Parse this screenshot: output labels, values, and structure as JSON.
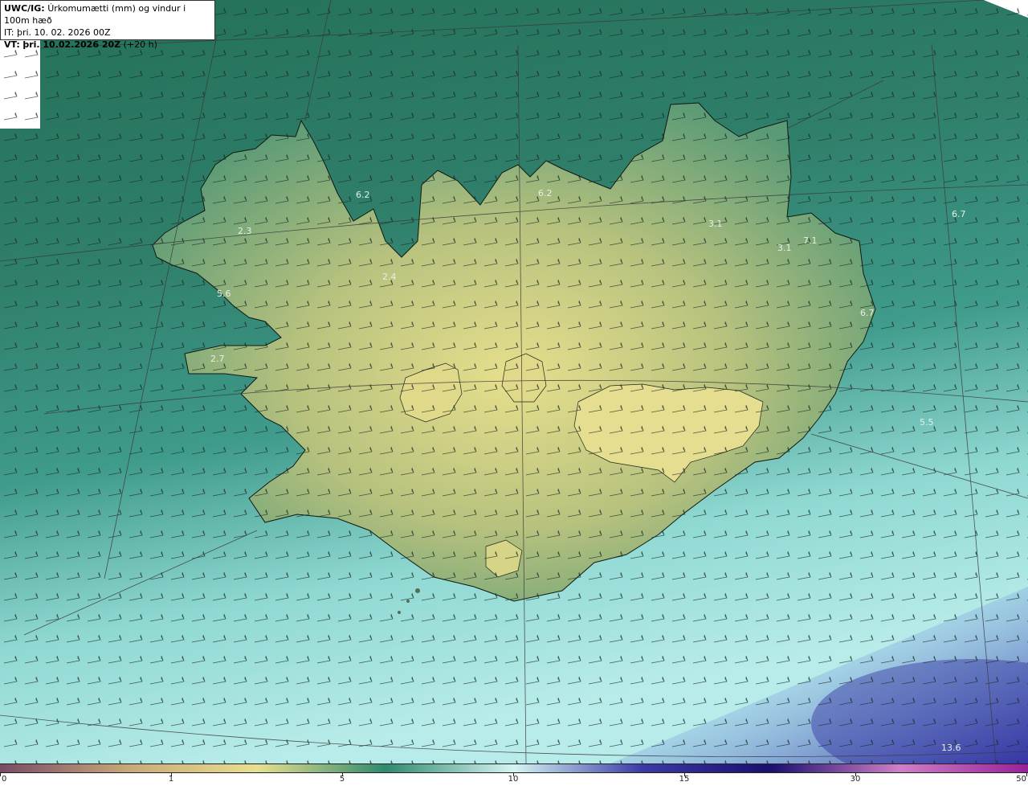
{
  "header": {
    "model": "UWC/IG:",
    "title": "Úrkomumætti (mm) og vindur i 100m hæð",
    "it_label": "IT:",
    "it_value": "þri. 10. 02. 2026 00Z",
    "vt_label": "VT:",
    "vt_value": "þri. 10.02.2026 20Z",
    "vt_lead": "(+20 h)"
  },
  "colorbar": {
    "ticks": [
      {
        "value": 0,
        "label": "0"
      },
      {
        "value": 1,
        "label": "1"
      },
      {
        "value": 5,
        "label": "5"
      },
      {
        "value": 10,
        "label": "10"
      },
      {
        "value": 15,
        "label": "15"
      },
      {
        "value": 30,
        "label": "30"
      },
      {
        "value": 50,
        "label": "50"
      }
    ],
    "colors": [
      "#7a4a66",
      "#c9a877",
      "#e8e08e",
      "#2f8a6e",
      "#d4f5f4",
      "#3a3aa8",
      "#1a0f70",
      "#d07fc8",
      "#9a1f9a"
    ]
  },
  "map_values": [
    {
      "label": "6.2"
    },
    {
      "label": "6.2"
    },
    {
      "label": "2.3"
    },
    {
      "label": "3.1"
    },
    {
      "label": "6.7"
    },
    {
      "label": "3.1"
    },
    {
      "label": "7.1"
    },
    {
      "label": "2.4"
    },
    {
      "label": "5.6"
    },
    {
      "label": "6.7"
    },
    {
      "label": "2.7"
    },
    {
      "label": "5.5"
    },
    {
      "label": "13.6"
    }
  ]
}
